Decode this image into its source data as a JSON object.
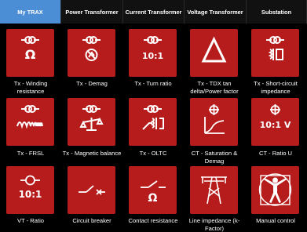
{
  "tabs": [
    {
      "label": "My TRAX",
      "active": true
    },
    {
      "label": "Power Transformer",
      "active": false
    },
    {
      "label": "Current Transformer",
      "active": false
    },
    {
      "label": "Voltage Transformer",
      "active": false
    },
    {
      "label": "Substation",
      "active": false
    }
  ],
  "colors": {
    "tile": "#b71c1c",
    "active_tab": "#4c8ed6",
    "background": "#000000"
  },
  "tiles": [
    {
      "label": "Tx - Winding resistance",
      "icon": "transformer-ohm-icon",
      "icon_text": "Ω"
    },
    {
      "label": "Tx - Demag",
      "icon": "transformer-demag-icon",
      "icon_text": ""
    },
    {
      "label": "Tx - Turn ratio",
      "icon": "transformer-ratio-icon",
      "icon_text": "10:1"
    },
    {
      "label": "Tx - TDX tan delta/Power factor",
      "icon": "warning-triangle-icon",
      "icon_text": ""
    },
    {
      "label": "Tx - Short-circuit impedance",
      "icon": "transformer-coil-icon",
      "icon_text": ""
    },
    {
      "label": "Tx - FRSL",
      "icon": "transformer-frequency-icon",
      "icon_text": ""
    },
    {
      "label": "Tx - Magnetic balance",
      "icon": "transformer-balance-icon",
      "icon_text": ""
    },
    {
      "label": "Tx - OLTC",
      "icon": "transformer-tap-changer-icon",
      "icon_text": ""
    },
    {
      "label": "CT - Saturation & Demag",
      "icon": "ct-saturation-curve-icon",
      "icon_text": ""
    },
    {
      "label": "CT - Ratio U",
      "icon": "ct-ratio-voltage-icon",
      "icon_text": "10:1 V"
    },
    {
      "label": "VT - Ratio",
      "icon": "vt-ratio-icon",
      "icon_text": "10:1"
    },
    {
      "label": "Circuit breaker",
      "icon": "circuit-breaker-icon",
      "icon_text": ""
    },
    {
      "label": "Contact resistance",
      "icon": "contact-resistance-icon",
      "icon_text": "Ω"
    },
    {
      "label": "Line impedance (k-Factor)",
      "icon": "power-line-tower-icon",
      "icon_text": ""
    },
    {
      "label": "Manual control",
      "icon": "manual-control-icon",
      "icon_text": ""
    }
  ]
}
